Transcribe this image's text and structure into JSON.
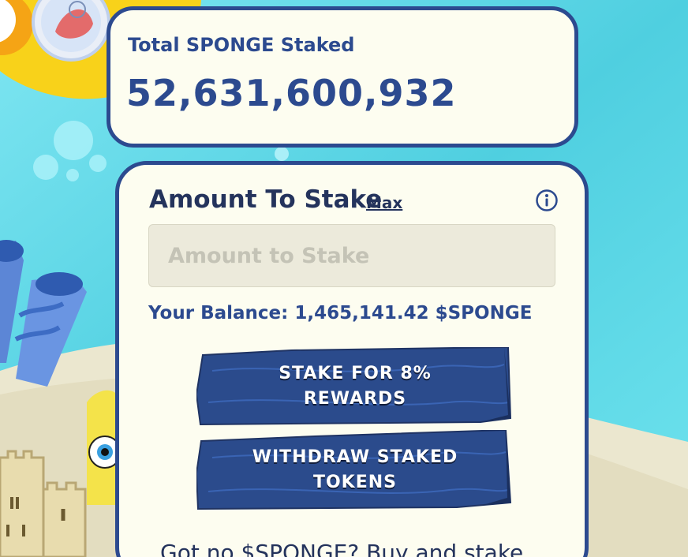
{
  "total_card": {
    "label": "Total SPONGE Staked",
    "value": "52,631,600,932"
  },
  "stake_card": {
    "title": "Amount To Stake",
    "max_label": "Max",
    "info_icon": "info-icon",
    "input": {
      "placeholder": "Amount to Stake",
      "value": ""
    },
    "balance_text": "Your Balance: 1,465,141.42 $SPONGE",
    "stake_button_label": "STAKE FOR 8% REWARDS",
    "withdraw_button_label": "WITHDRAW STAKED TOKENS",
    "buy_text": "Got no $SPONGE? Buy and stake"
  },
  "colors": {
    "card_border": "#2c4a8f",
    "card_bg": "#fdfdf0",
    "plank": "#2b4b8c",
    "water": "#5fd3e4",
    "sand": "#ebe7cf"
  }
}
